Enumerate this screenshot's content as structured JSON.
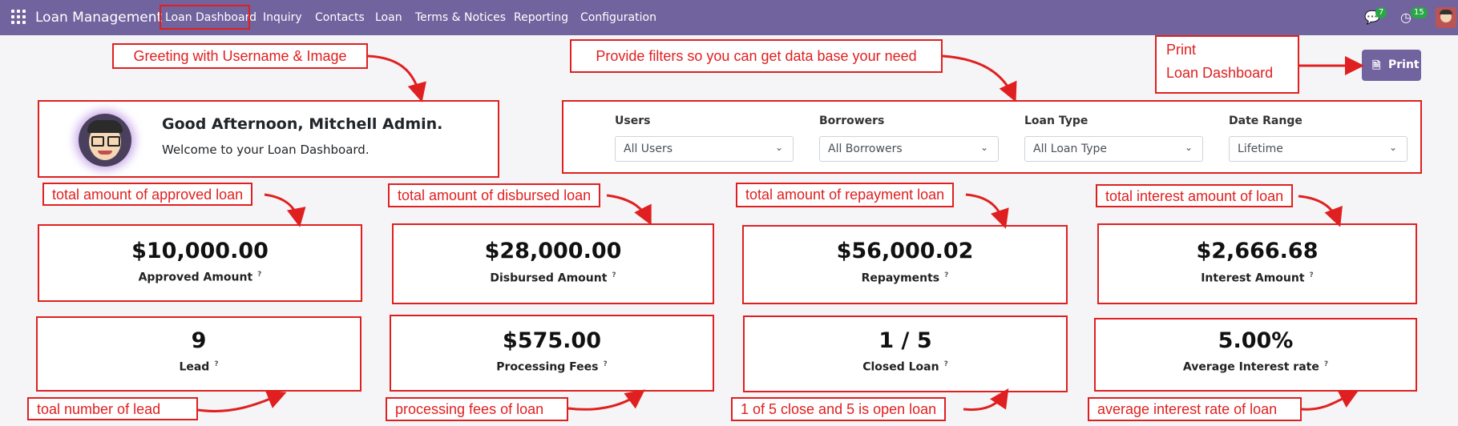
{
  "topbar": {
    "app_name": "Loan Management",
    "menu": [
      "Loan Dashboard",
      "Inquiry",
      "Contacts",
      "Loan",
      "Terms & Notices",
      "Reporting",
      "Configuration"
    ],
    "chat_badge": "7",
    "activity_badge": "15"
  },
  "greeting": {
    "title": "Good Afternoon, Mitchell Admin.",
    "subtitle": "Welcome to your Loan Dashboard."
  },
  "filters": [
    {
      "label": "Users",
      "value": "All Users"
    },
    {
      "label": "Borrowers",
      "value": "All Borrowers"
    },
    {
      "label": "Loan Type",
      "value": "All Loan Type"
    },
    {
      "label": "Date Range",
      "value": "Lifetime"
    }
  ],
  "print": {
    "label": "Print"
  },
  "stats": [
    {
      "value": "$10,000.00",
      "label": "Approved Amount",
      "help": "?"
    },
    {
      "value": "$28,000.00",
      "label": "Disbursed Amount",
      "help": "?"
    },
    {
      "value": "$56,000.02",
      "label": "Repayments",
      "help": "?"
    },
    {
      "value": "$2,666.68",
      "label": "Interest Amount",
      "help": "?"
    },
    {
      "value": "9",
      "label": "Lead",
      "help": "?"
    },
    {
      "value": "$575.00",
      "label": "Processing Fees",
      "help": "?"
    },
    {
      "value": "1 / 5",
      "label": "Closed Loan",
      "help": "?"
    },
    {
      "value": "5.00%",
      "label": "Average Interest rate",
      "help": "?"
    }
  ],
  "annotations": {
    "greeting": "Greeting with Username & Image",
    "filters": "Provide filters so you can get data base your need",
    "print_line1": "Print",
    "print_line2": "Loan Dashboard",
    "approved": "total amount of approved loan",
    "disbursed": "total amount of disbursed loan",
    "repayment": "total amount of repayment loan",
    "interest": "total interest amount of loan",
    "lead": "toal number of lead",
    "fees": "processing fees of loan",
    "closed": "1 of 5 close and 5 is open loan",
    "avg_rate": "average interest rate of loan"
  },
  "colors": {
    "brand": "#71639e",
    "annotation": "#e02020",
    "badge": "#28a745"
  }
}
